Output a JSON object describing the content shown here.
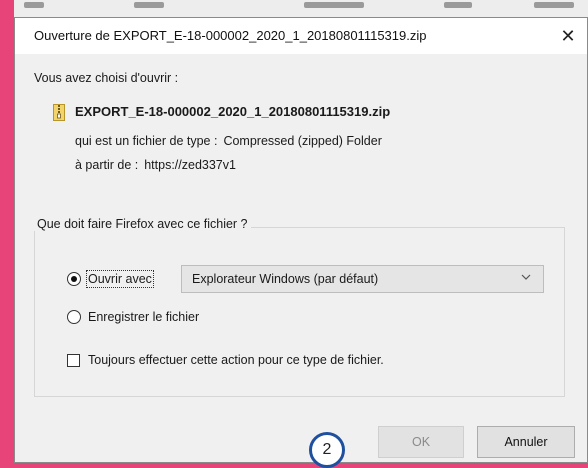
{
  "dialog": {
    "title": "Ouverture de EXPORT_E-18-000002_2020_1_20180801115319.zip",
    "close_glyph": "✕"
  },
  "file": {
    "intro": "Vous avez choisi d'ouvrir :",
    "icon": "zip-file-icon",
    "name": "EXPORT_E-18-000002_2020_1_20180801115319.zip",
    "type_label": "qui est un fichier de type :",
    "type_value": "Compressed (zipped) Folder",
    "from_label": "à partir de :",
    "from_value": "https://zed337v1"
  },
  "action": {
    "legend": "Que doit faire Firefox avec ce fichier ?",
    "open_with_label": "Ouvrir avec",
    "open_with_selected": true,
    "application": "Explorateur Windows (par défaut)",
    "save_label": "Enregistrer le fichier",
    "save_selected": false,
    "always_label": "Toujours effectuer cette action pour ce type de fichier.",
    "always_checked": false
  },
  "buttons": {
    "ok": "OK",
    "cancel": "Annuler"
  },
  "annotation": {
    "step": "2",
    "color": "#1f4f9f"
  },
  "colors": {
    "frame": "#e7447a"
  }
}
